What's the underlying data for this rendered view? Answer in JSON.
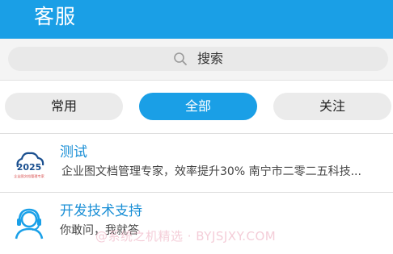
{
  "header": {
    "title": "客服"
  },
  "search": {
    "placeholder": "搜索",
    "icon": "search-icon"
  },
  "tabs": [
    {
      "label": "常用",
      "active": false
    },
    {
      "label": "全部",
      "active": true
    },
    {
      "label": "关注",
      "active": false
    }
  ],
  "contacts": [
    {
      "name": "测试",
      "description": "企业图文档管理专家，效率提升30% 南宁市二零二五科技...",
      "avatar_icon": "2025-logo-icon",
      "avatar_text": "2025",
      "avatar_caption": "企业图文档管理专家"
    },
    {
      "name": "开发技术支持",
      "description": "你敢问，我就答",
      "avatar_icon": "headset-support-icon"
    }
  ],
  "watermark": "@系统之机精选 · BYJSJXY.COM",
  "colors": {
    "accent": "#1a9fe6",
    "title_link": "#1a8fd6",
    "tab_inactive": "#ebebeb"
  }
}
